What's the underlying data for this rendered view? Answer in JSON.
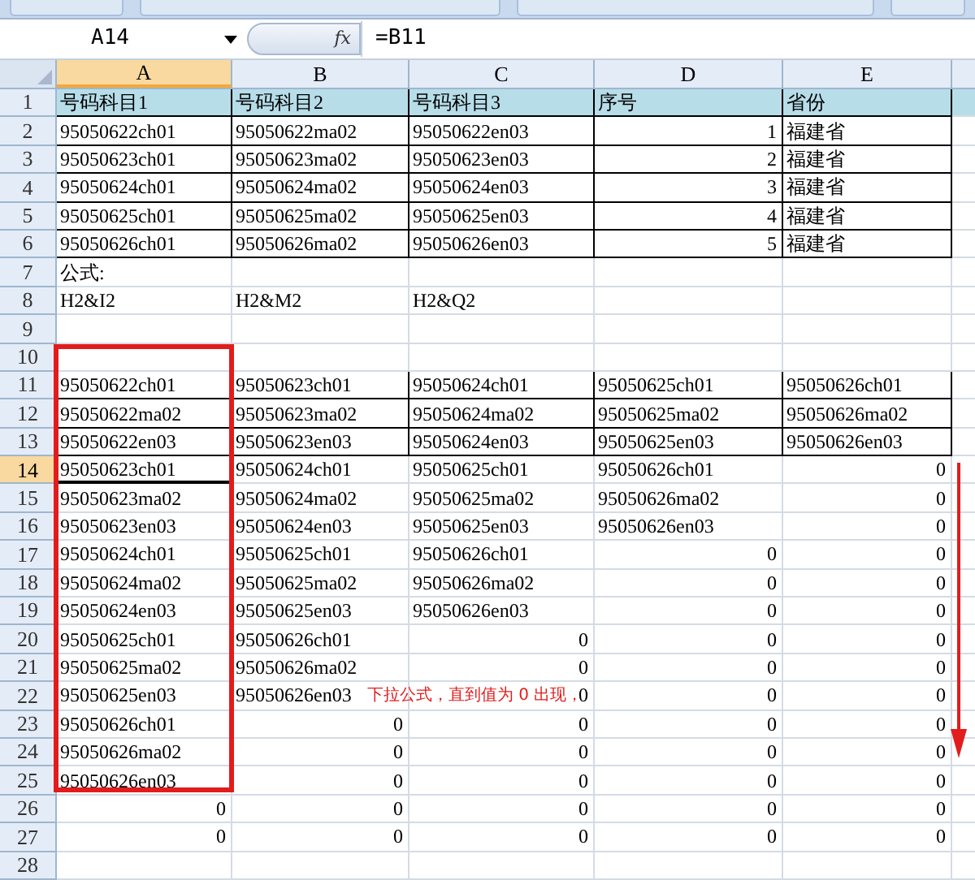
{
  "formula_bar": {
    "name_box": "A14",
    "fx_label": "fx",
    "formula": "=B11"
  },
  "columns": [
    {
      "label": "A",
      "selected": true
    },
    {
      "label": "B",
      "selected": false
    },
    {
      "label": "C",
      "selected": false
    },
    {
      "label": "D",
      "selected": false
    },
    {
      "label": "E",
      "selected": false
    }
  ],
  "rows": [
    {
      "label": "1",
      "selected": false,
      "header_fill": true,
      "bordered": true,
      "cells": [
        {
          "text": "号码科目1",
          "kind": "text"
        },
        {
          "text": "号码科目2",
          "kind": "text"
        },
        {
          "text": "号码科目3",
          "kind": "text"
        },
        {
          "text": "序号",
          "kind": "text"
        },
        {
          "text": "省份",
          "kind": "text"
        }
      ]
    },
    {
      "label": "2",
      "selected": false,
      "header_fill": false,
      "bordered": true,
      "cells": [
        {
          "text": "95050622ch01",
          "kind": "text"
        },
        {
          "text": "95050622ma02",
          "kind": "text"
        },
        {
          "text": "95050622en03",
          "kind": "text"
        },
        {
          "text": "1",
          "kind": "number"
        },
        {
          "text": "福建省",
          "kind": "text"
        }
      ]
    },
    {
      "label": "3",
      "selected": false,
      "header_fill": false,
      "bordered": true,
      "cells": [
        {
          "text": "95050623ch01",
          "kind": "text"
        },
        {
          "text": "95050623ma02",
          "kind": "text"
        },
        {
          "text": "95050623en03",
          "kind": "text"
        },
        {
          "text": "2",
          "kind": "number"
        },
        {
          "text": "福建省",
          "kind": "text"
        }
      ]
    },
    {
      "label": "4",
      "selected": false,
      "header_fill": false,
      "bordered": true,
      "cells": [
        {
          "text": "95050624ch01",
          "kind": "text"
        },
        {
          "text": "95050624ma02",
          "kind": "text"
        },
        {
          "text": "95050624en03",
          "kind": "text"
        },
        {
          "text": "3",
          "kind": "number"
        },
        {
          "text": "福建省",
          "kind": "text"
        }
      ]
    },
    {
      "label": "5",
      "selected": false,
      "header_fill": false,
      "bordered": true,
      "cells": [
        {
          "text": "95050625ch01",
          "kind": "text"
        },
        {
          "text": "95050625ma02",
          "kind": "text"
        },
        {
          "text": "95050625en03",
          "kind": "text"
        },
        {
          "text": "4",
          "kind": "number"
        },
        {
          "text": "福建省",
          "kind": "text"
        }
      ]
    },
    {
      "label": "6",
      "selected": false,
      "header_fill": false,
      "bordered": true,
      "cells": [
        {
          "text": "95050626ch01",
          "kind": "text"
        },
        {
          "text": "95050626ma02",
          "kind": "text"
        },
        {
          "text": "95050626en03",
          "kind": "text"
        },
        {
          "text": "5",
          "kind": "number"
        },
        {
          "text": "福建省",
          "kind": "text"
        }
      ]
    },
    {
      "label": "7",
      "selected": false,
      "header_fill": false,
      "bordered": false,
      "cells": [
        {
          "text": "公式:",
          "kind": "text"
        },
        null,
        null,
        null,
        null
      ]
    },
    {
      "label": "8",
      "selected": false,
      "header_fill": false,
      "bordered": false,
      "cells": [
        {
          "text": "H2&I2",
          "kind": "text"
        },
        {
          "text": "H2&M2",
          "kind": "text"
        },
        {
          "text": "H2&Q2",
          "kind": "text"
        },
        null,
        null
      ]
    },
    {
      "label": "9",
      "selected": false,
      "header_fill": false,
      "bordered": false,
      "cells": [
        null,
        null,
        null,
        null,
        null
      ]
    },
    {
      "label": "10",
      "selected": false,
      "header_fill": false,
      "bordered": false,
      "cells": [
        null,
        null,
        null,
        null,
        null
      ]
    },
    {
      "label": "11",
      "selected": false,
      "header_fill": false,
      "bordered": true,
      "cells": [
        {
          "text": "95050622ch01",
          "kind": "text"
        },
        {
          "text": "95050623ch01",
          "kind": "text"
        },
        {
          "text": "95050624ch01",
          "kind": "text"
        },
        {
          "text": "95050625ch01",
          "kind": "text"
        },
        {
          "text": "95050626ch01",
          "kind": "text"
        }
      ]
    },
    {
      "label": "12",
      "selected": false,
      "header_fill": false,
      "bordered": true,
      "cells": [
        {
          "text": "95050622ma02",
          "kind": "text"
        },
        {
          "text": "95050623ma02",
          "kind": "text"
        },
        {
          "text": "95050624ma02",
          "kind": "text"
        },
        {
          "text": "95050625ma02",
          "kind": "text"
        },
        {
          "text": "95050626ma02",
          "kind": "text"
        }
      ]
    },
    {
      "label": "13",
      "selected": false,
      "header_fill": false,
      "bordered": true,
      "cells": [
        {
          "text": "95050622en03",
          "kind": "text"
        },
        {
          "text": "95050623en03",
          "kind": "text"
        },
        {
          "text": "95050624en03",
          "kind": "text"
        },
        {
          "text": "95050625en03",
          "kind": "text"
        },
        {
          "text": "95050626en03",
          "kind": "text"
        }
      ]
    },
    {
      "label": "14",
      "selected": true,
      "header_fill": false,
      "bordered": false,
      "cells": [
        {
          "text": "95050623ch01",
          "kind": "text"
        },
        {
          "text": "95050624ch01",
          "kind": "text"
        },
        {
          "text": "95050625ch01",
          "kind": "text"
        },
        {
          "text": "95050626ch01",
          "kind": "text"
        },
        {
          "text": "0",
          "kind": "number"
        }
      ]
    },
    {
      "label": "15",
      "selected": false,
      "header_fill": false,
      "bordered": false,
      "cells": [
        {
          "text": "95050623ma02",
          "kind": "text"
        },
        {
          "text": "95050624ma02",
          "kind": "text"
        },
        {
          "text": "95050625ma02",
          "kind": "text"
        },
        {
          "text": "95050626ma02",
          "kind": "text"
        },
        {
          "text": "0",
          "kind": "number"
        }
      ]
    },
    {
      "label": "16",
      "selected": false,
      "header_fill": false,
      "bordered": false,
      "cells": [
        {
          "text": "95050623en03",
          "kind": "text"
        },
        {
          "text": "95050624en03",
          "kind": "text"
        },
        {
          "text": "95050625en03",
          "kind": "text"
        },
        {
          "text": "95050626en03",
          "kind": "text"
        },
        {
          "text": "0",
          "kind": "number"
        }
      ]
    },
    {
      "label": "17",
      "selected": false,
      "header_fill": false,
      "bordered": false,
      "cells": [
        {
          "text": "95050624ch01",
          "kind": "text"
        },
        {
          "text": "95050625ch01",
          "kind": "text"
        },
        {
          "text": "95050626ch01",
          "kind": "text"
        },
        {
          "text": "0",
          "kind": "number"
        },
        {
          "text": "0",
          "kind": "number"
        }
      ]
    },
    {
      "label": "18",
      "selected": false,
      "header_fill": false,
      "bordered": false,
      "cells": [
        {
          "text": "95050624ma02",
          "kind": "text"
        },
        {
          "text": "95050625ma02",
          "kind": "text"
        },
        {
          "text": "95050626ma02",
          "kind": "text"
        },
        {
          "text": "0",
          "kind": "number"
        },
        {
          "text": "0",
          "kind": "number"
        }
      ]
    },
    {
      "label": "19",
      "selected": false,
      "header_fill": false,
      "bordered": false,
      "cells": [
        {
          "text": "95050624en03",
          "kind": "text"
        },
        {
          "text": "95050625en03",
          "kind": "text"
        },
        {
          "text": "95050626en03",
          "kind": "text"
        },
        {
          "text": "0",
          "kind": "number"
        },
        {
          "text": "0",
          "kind": "number"
        }
      ]
    },
    {
      "label": "20",
      "selected": false,
      "header_fill": false,
      "bordered": false,
      "cells": [
        {
          "text": "95050625ch01",
          "kind": "text"
        },
        {
          "text": "95050626ch01",
          "kind": "text"
        },
        {
          "text": "0",
          "kind": "number"
        },
        {
          "text": "0",
          "kind": "number"
        },
        {
          "text": "0",
          "kind": "number"
        }
      ]
    },
    {
      "label": "21",
      "selected": false,
      "header_fill": false,
      "bordered": false,
      "cells": [
        {
          "text": "95050625ma02",
          "kind": "text"
        },
        {
          "text": "95050626ma02",
          "kind": "text"
        },
        {
          "text": "0",
          "kind": "number"
        },
        {
          "text": "0",
          "kind": "number"
        },
        {
          "text": "0",
          "kind": "number"
        }
      ]
    },
    {
      "label": "22",
      "selected": false,
      "header_fill": false,
      "bordered": false,
      "cells": [
        {
          "text": "95050625en03",
          "kind": "text"
        },
        {
          "text": "95050626en03",
          "kind": "text"
        },
        {
          "text": "0",
          "kind": "number"
        },
        {
          "text": "0",
          "kind": "number"
        },
        {
          "text": "0",
          "kind": "number"
        }
      ]
    },
    {
      "label": "23",
      "selected": false,
      "header_fill": false,
      "bordered": false,
      "cells": [
        {
          "text": "95050626ch01",
          "kind": "text"
        },
        {
          "text": "0",
          "kind": "number"
        },
        {
          "text": "0",
          "kind": "number"
        },
        {
          "text": "0",
          "kind": "number"
        },
        {
          "text": "0",
          "kind": "number"
        }
      ]
    },
    {
      "label": "24",
      "selected": false,
      "header_fill": false,
      "bordered": false,
      "cells": [
        {
          "text": "95050626ma02",
          "kind": "text"
        },
        {
          "text": "0",
          "kind": "number"
        },
        {
          "text": "0",
          "kind": "number"
        },
        {
          "text": "0",
          "kind": "number"
        },
        {
          "text": "0",
          "kind": "number"
        }
      ]
    },
    {
      "label": "25",
      "selected": false,
      "header_fill": false,
      "bordered": false,
      "cells": [
        {
          "text": "95050626en03",
          "kind": "text"
        },
        {
          "text": "0",
          "kind": "number"
        },
        {
          "text": "0",
          "kind": "number"
        },
        {
          "text": "0",
          "kind": "number"
        },
        {
          "text": "0",
          "kind": "number"
        }
      ]
    },
    {
      "label": "26",
      "selected": false,
      "header_fill": false,
      "bordered": false,
      "cells": [
        {
          "text": "0",
          "kind": "number"
        },
        {
          "text": "0",
          "kind": "number"
        },
        {
          "text": "0",
          "kind": "number"
        },
        {
          "text": "0",
          "kind": "number"
        },
        {
          "text": "0",
          "kind": "number"
        }
      ]
    },
    {
      "label": "27",
      "selected": false,
      "header_fill": false,
      "bordered": false,
      "cells": [
        {
          "text": "0",
          "kind": "number"
        },
        {
          "text": "0",
          "kind": "number"
        },
        {
          "text": "0",
          "kind": "number"
        },
        {
          "text": "0",
          "kind": "number"
        },
        {
          "text": "0",
          "kind": "number"
        }
      ]
    },
    {
      "label": "28",
      "selected": false,
      "header_fill": false,
      "bordered": false,
      "cells": [
        null,
        null,
        null,
        null,
        null
      ]
    }
  ],
  "annotation": {
    "note": "下拉公式，直到值为 0 出现，"
  }
}
